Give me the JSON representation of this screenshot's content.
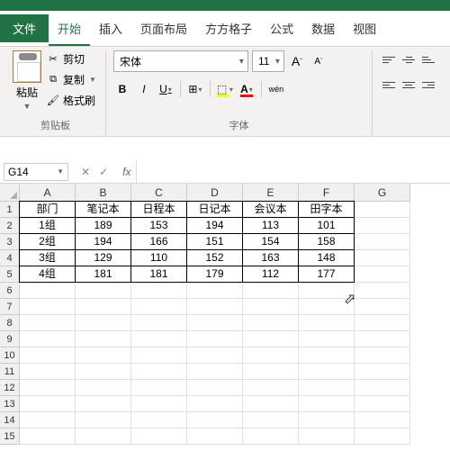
{
  "menu": {
    "file": "文件",
    "tabs": [
      "开始",
      "插入",
      "页面布局",
      "方方格子",
      "公式",
      "数据",
      "视图"
    ]
  },
  "clipboard": {
    "paste": "粘贴",
    "cut": "剪切",
    "copy": "复制",
    "format_painter": "格式刷",
    "group_label": "剪贴板"
  },
  "font": {
    "name": "宋体",
    "size": "11",
    "increase": "A",
    "decrease": "A",
    "bold": "B",
    "italic": "I",
    "underline": "U",
    "ruby": "wén",
    "group_label": "字体"
  },
  "namebox": "G14",
  "fx": {
    "cancel": "✕",
    "confirm": "✓",
    "fx": "fx"
  },
  "chart_data": {
    "type": "table",
    "columns": [
      "A",
      "B",
      "C",
      "D",
      "E",
      "F"
    ],
    "headers": [
      "部门",
      "笔记本",
      "日程本",
      "日记本",
      "会议本",
      "田字本"
    ],
    "rows": [
      [
        "1组",
        189,
        153,
        194,
        113,
        101
      ],
      [
        "2组",
        194,
        166,
        151,
        154,
        158
      ],
      [
        "3组",
        129,
        110,
        152,
        163,
        148
      ],
      [
        "4组",
        181,
        181,
        179,
        112,
        177
      ]
    ]
  },
  "row_labels": [
    "1",
    "2",
    "3",
    "4",
    "5",
    "6",
    "7",
    "8",
    "9",
    "10",
    "11",
    "12",
    "13",
    "14",
    "15"
  ]
}
